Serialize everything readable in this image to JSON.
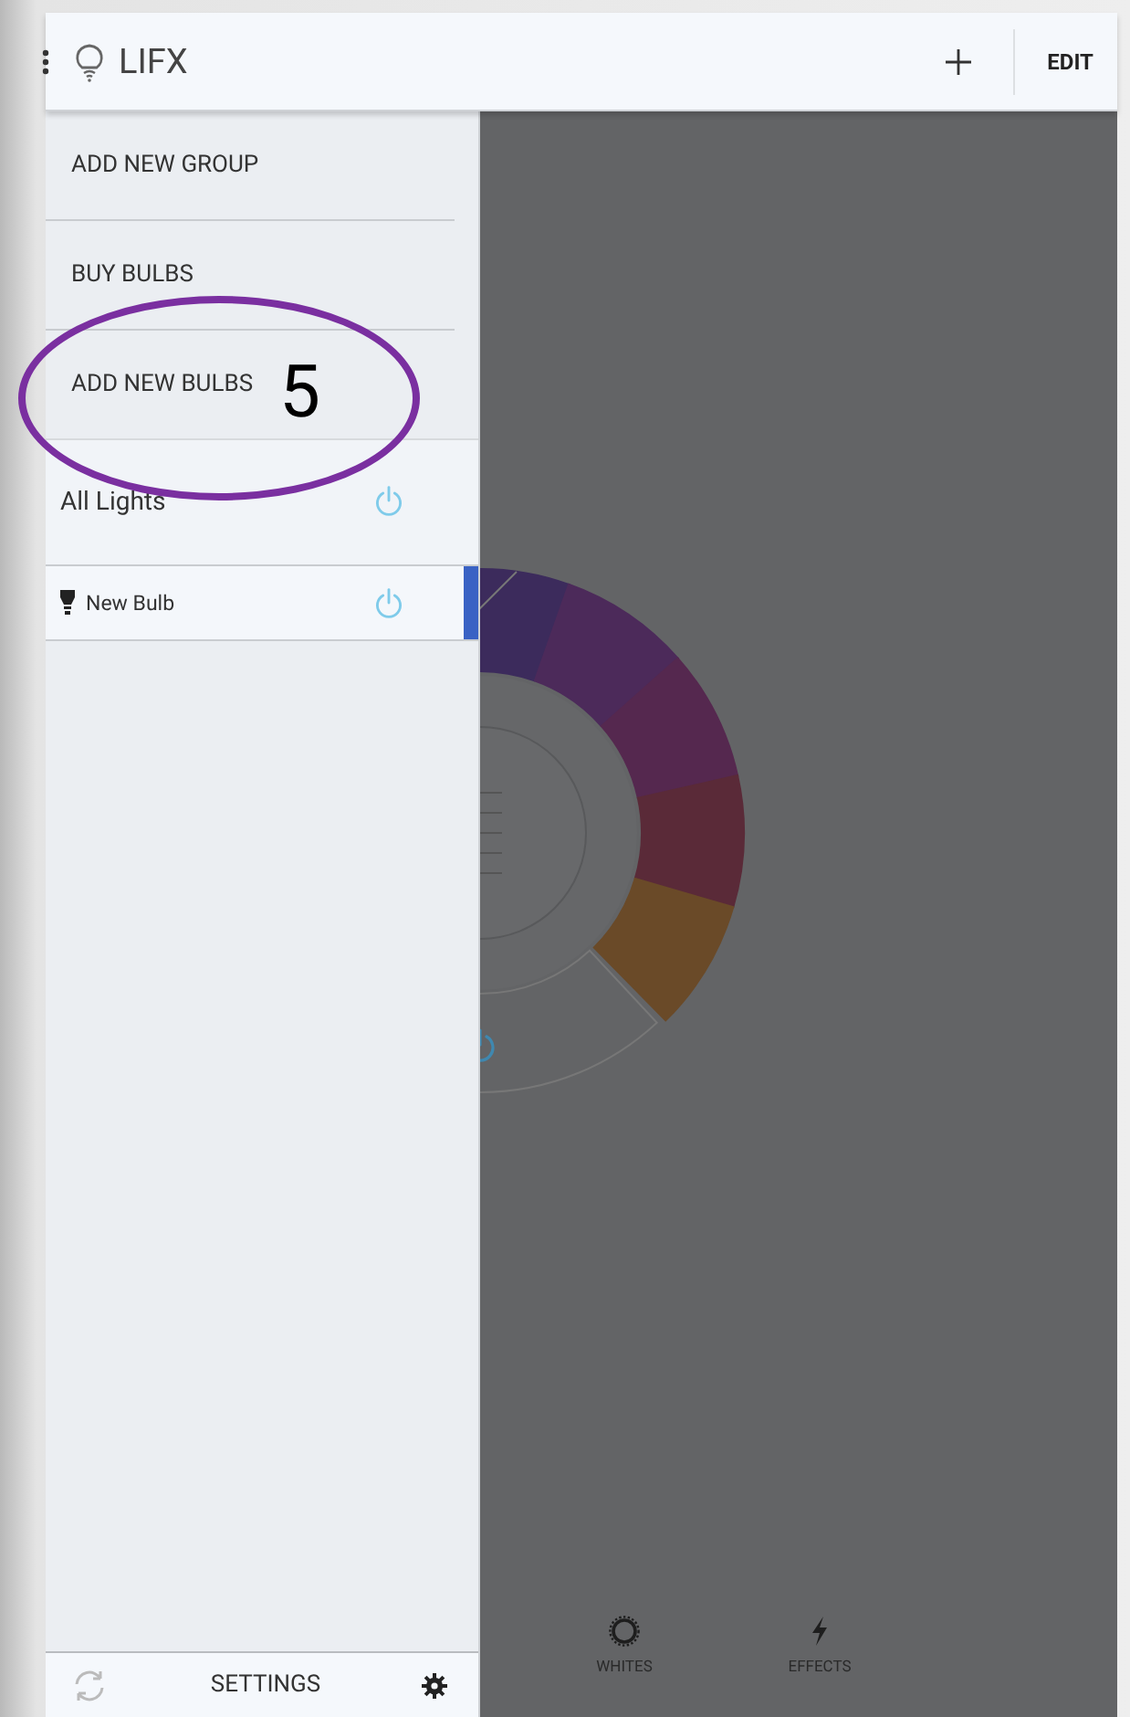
{
  "header": {
    "title": "LIFX",
    "edit": "EDIT"
  },
  "drawer": {
    "menu_items": [
      "ADD NEW GROUP",
      "BUY BULBS",
      "ADD NEW BULBS"
    ],
    "lights": [
      {
        "name": "All Lights",
        "kind": "group",
        "selected": false
      },
      {
        "name": "New Bulb",
        "kind": "bulb",
        "selected": true
      }
    ],
    "footer": {
      "settings": "SETTINGS"
    }
  },
  "main": {
    "tabs": [
      {
        "label": "WHITES",
        "kind": "whites"
      },
      {
        "label": "EFFECTS",
        "kind": "effects"
      }
    ]
  },
  "annotation": {
    "label": "5"
  }
}
